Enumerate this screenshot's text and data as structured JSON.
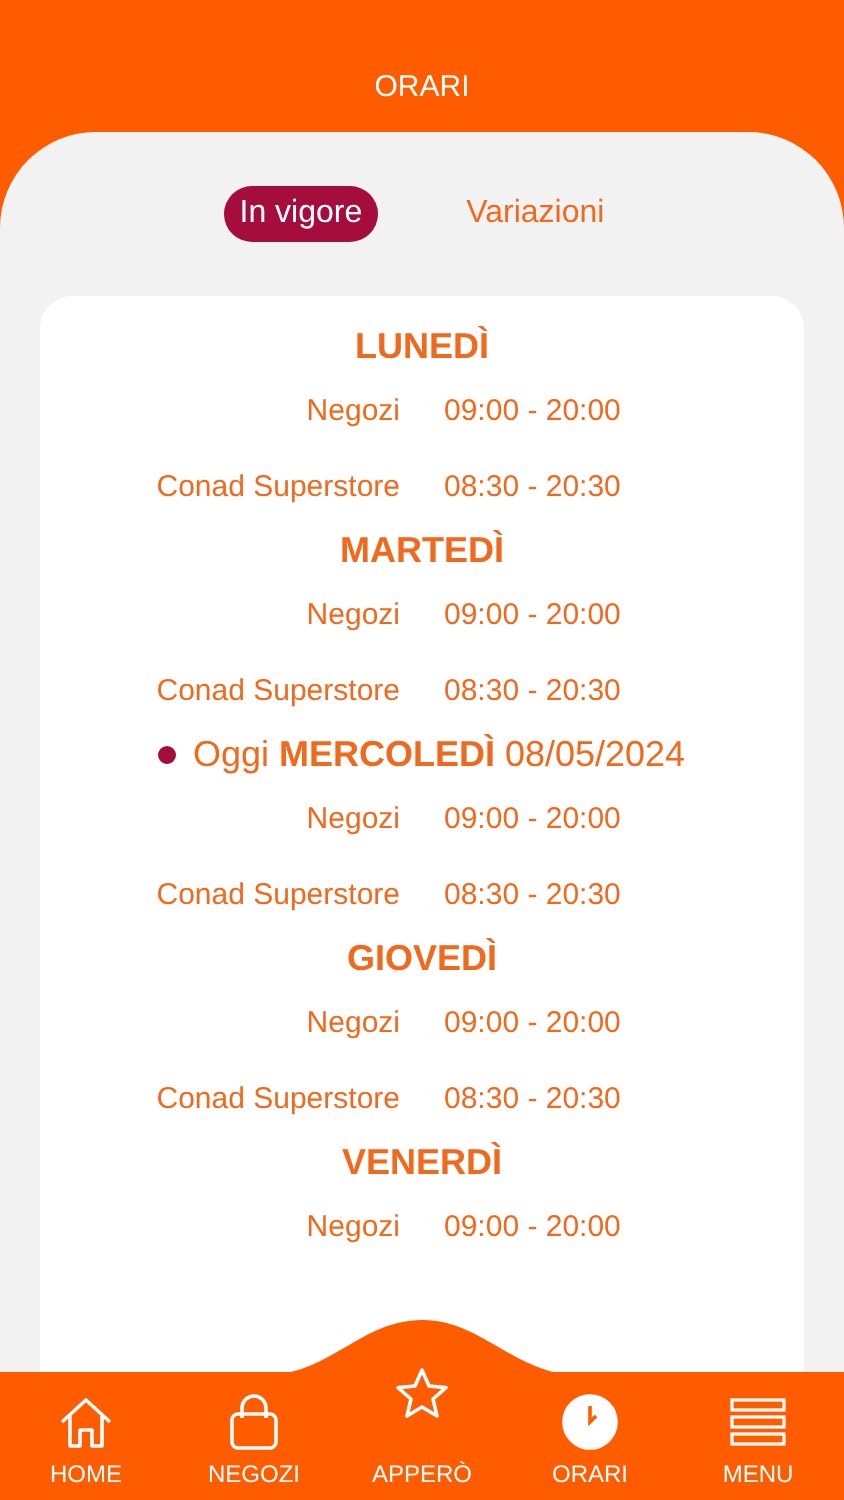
{
  "header": {
    "title": "ORARI"
  },
  "tabs": [
    {
      "label": "In vigore",
      "selected": true
    },
    {
      "label": "Variazioni",
      "selected": false
    }
  ],
  "days": [
    {
      "heading": "LUNEDÌ",
      "today": false,
      "rows": [
        {
          "label": "Negozi",
          "hours": "09:00 - 20:00"
        },
        {
          "label": "Conad Superstore",
          "hours": "08:30 - 20:30"
        }
      ]
    },
    {
      "heading": "MARTEDÌ",
      "today": false,
      "rows": [
        {
          "label": "Negozi",
          "hours": "09:00 - 20:00"
        },
        {
          "label": "Conad Superstore",
          "hours": "08:30 - 20:30"
        }
      ]
    },
    {
      "heading": "Oggi **MERCOLEDÌ** 08/05/2024",
      "today": true,
      "rows": [
        {
          "label": "Negozi",
          "hours": "09:00 - 20:00"
        },
        {
          "label": "Conad Superstore",
          "hours": "08:30 - 20:30"
        }
      ]
    },
    {
      "heading": "GIOVEDÌ",
      "today": false,
      "rows": [
        {
          "label": "Negozi",
          "hours": "09:00 - 20:00"
        },
        {
          "label": "Conad Superstore",
          "hours": "08:30 - 20:30"
        }
      ]
    },
    {
      "heading": "VENERDÌ",
      "today": false,
      "rows": [
        {
          "label": "Negozi",
          "hours": "09:00 - 20:00"
        }
      ]
    }
  ],
  "nav": [
    {
      "kind": "home",
      "label": "HOME",
      "selected": false
    },
    {
      "kind": "bag",
      "label": "NEGOZI",
      "selected": false
    },
    {
      "kind": "star",
      "label": "APPERÒ",
      "selected": false
    },
    {
      "kind": "clock",
      "label": "ORARI",
      "selected": true
    },
    {
      "kind": "menu",
      "label": "MENU",
      "selected": false
    }
  ]
}
